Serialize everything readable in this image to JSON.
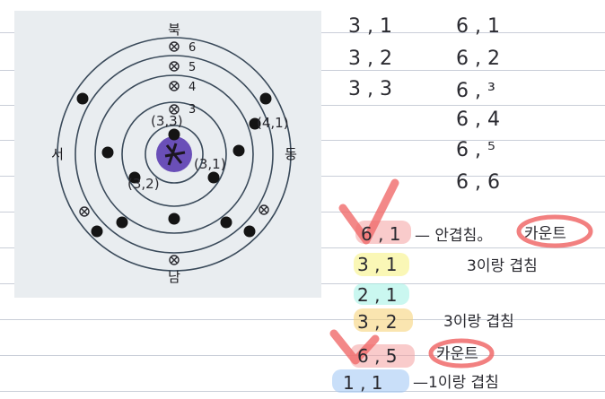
{
  "photo": {
    "compass": {
      "north": "북",
      "south": "남",
      "west": "서",
      "east": "동"
    },
    "ring_labels": [
      "6",
      "5",
      "4",
      "3"
    ],
    "pos_labels": [
      "(3,3)",
      "(4,1)",
      "(3,1)",
      "(3,2)"
    ]
  },
  "notes": {
    "col1": [
      "3 , 1",
      "3 , 2",
      "3 , 3"
    ],
    "col2": [
      "6 , 1",
      "6 , 2",
      "6 , ³",
      "6 , 4",
      "6 , ⁵",
      "6 , 6"
    ],
    "checklist": [
      {
        "code": "6 , 1",
        "text": "— 안겹침。",
        "tag": "카운트",
        "highlight": "#f4a0a0"
      },
      {
        "code": "3 , 1",
        "text": "3이랑 겹침",
        "tag": "",
        "highlight": "#f6f07a"
      },
      {
        "code": "2 , 1",
        "text": "",
        "tag": "",
        "highlight": "#9ff0e4"
      },
      {
        "code": "3 , 2",
        "text": "3이랑 겹침",
        "tag": "",
        "highlight": "#f6d070"
      },
      {
        "code": "6 , 5",
        "text": "",
        "tag": "카운트",
        "highlight": "#f4a0a0"
      },
      {
        "code": "1 , 1",
        "text": "—1이랑 겹침",
        "tag": "",
        "highlight": "#9cc4f4"
      }
    ]
  },
  "colors": {
    "ink": "#2a2a30",
    "circle": "#3a4a5a",
    "photo_bg": "#e9edf0",
    "ring_red": "#f06a6a"
  }
}
